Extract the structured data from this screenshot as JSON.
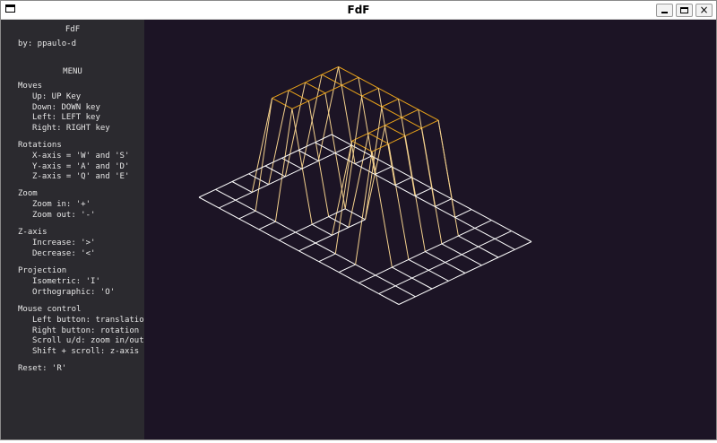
{
  "window": {
    "title": "FdF",
    "close_glyph": "×"
  },
  "sidebar": {
    "title": "FdF",
    "author": "by: ppaulo-d",
    "menu_heading": "MENU",
    "moves": {
      "heading": "Moves",
      "items": [
        "Up: UP Key",
        "Down: DOWN key",
        "Left: LEFT key",
        "Right: RIGHT key"
      ]
    },
    "rotations": {
      "heading": "Rotations",
      "items": [
        "X-axis = 'W' and 'S'",
        "Y-axis = 'A' and 'D'",
        "Z-axis = 'Q' and 'E'"
      ]
    },
    "zoom": {
      "heading": "Zoom",
      "items": [
        "Zoom in: '+'",
        "Zoom out: '-'"
      ]
    },
    "zaxis": {
      "heading": "Z-axis",
      "items": [
        "Increase: '>'",
        "Decrease: '<'"
      ]
    },
    "projection": {
      "heading": "Projection",
      "items": [
        "Isometric: 'I'",
        "Orthographic: 'O'"
      ]
    },
    "mouse": {
      "heading": "Mouse control",
      "items": [
        "Left button: translation",
        "Right button: rotation",
        "Scroll u/d: zoom in/out",
        "Shift + scroll: z-axis"
      ]
    },
    "reset": "Reset: 'R'"
  },
  "map": {
    "grid": [
      [
        0,
        0,
        0,
        0,
        0,
        0,
        0,
        0,
        0,
        0,
        0
      ],
      [
        0,
        0,
        0,
        0,
        0,
        0,
        0,
        0,
        0,
        0,
        0
      ],
      [
        0,
        0,
        10,
        10,
        0,
        0,
        10,
        10,
        0,
        0,
        0
      ],
      [
        0,
        0,
        10,
        10,
        0,
        0,
        10,
        10,
        0,
        0,
        0
      ],
      [
        0,
        0,
        10,
        10,
        0,
        0,
        10,
        10,
        0,
        0,
        0
      ],
      [
        0,
        0,
        10,
        10,
        10,
        10,
        10,
        10,
        0,
        0,
        0
      ],
      [
        0,
        0,
        10,
        10,
        10,
        10,
        10,
        10,
        0,
        0,
        0
      ],
      [
        0,
        0,
        0,
        0,
        0,
        0,
        0,
        0,
        0,
        0,
        0
      ],
      [
        0,
        0,
        0,
        0,
        0,
        0,
        0,
        0,
        0,
        0,
        0
      ]
    ],
    "colors": {
      "low": "#ffffff",
      "high": "#e8a21a",
      "background": "#1c1425"
    }
  }
}
